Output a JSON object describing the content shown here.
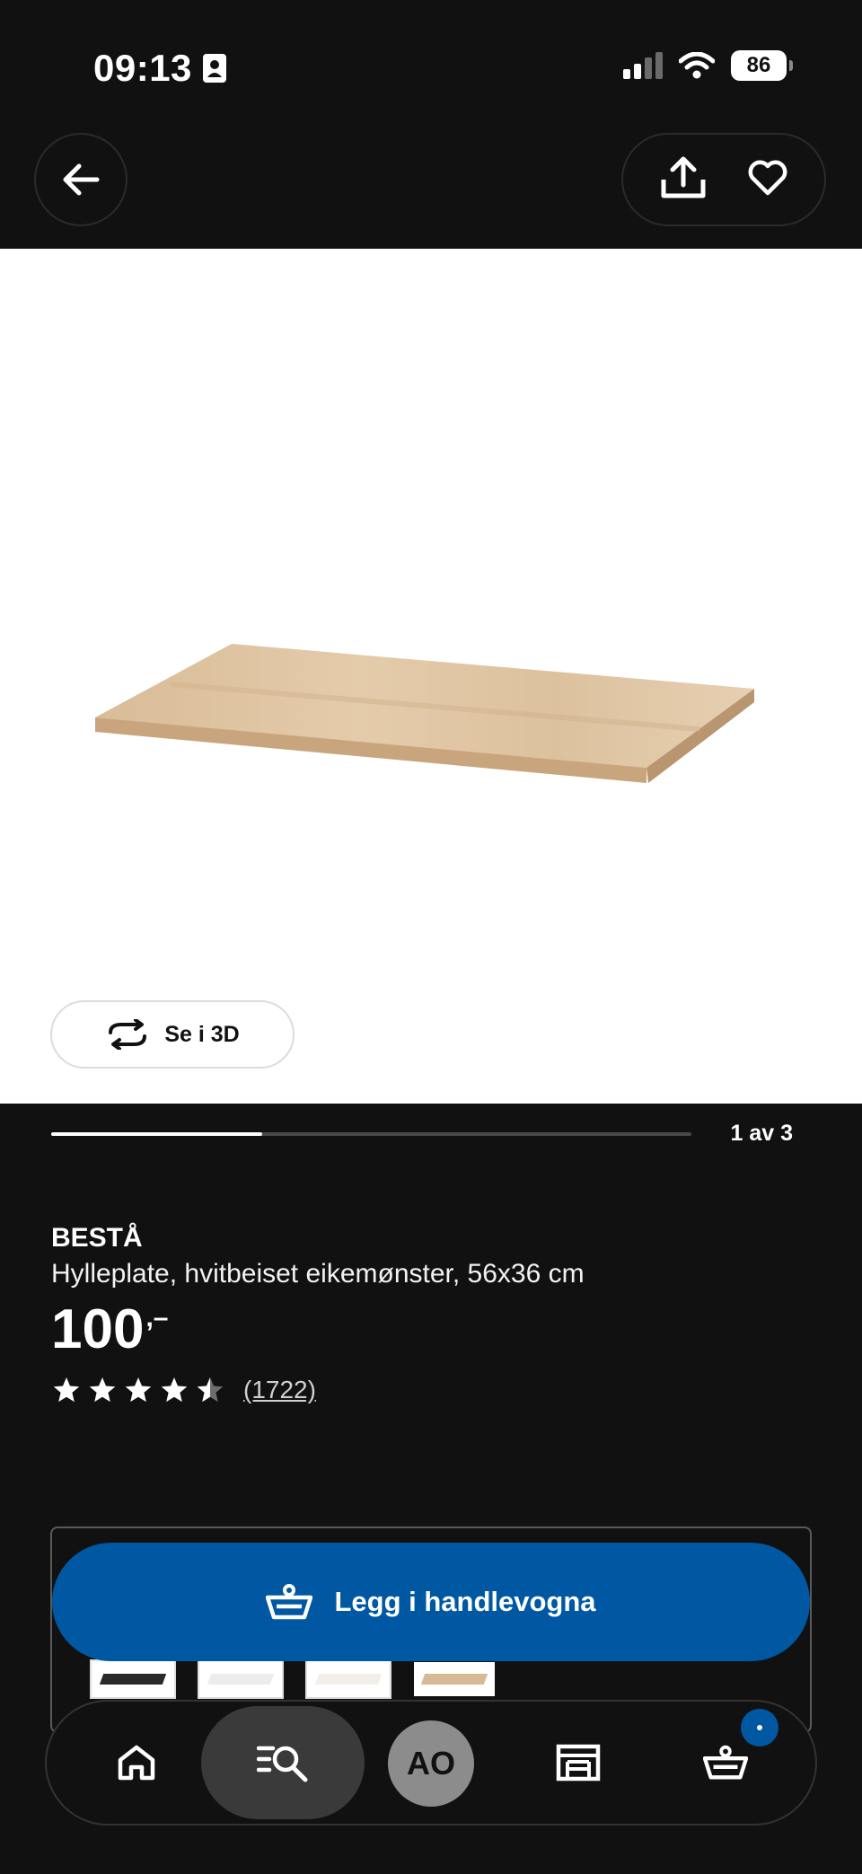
{
  "status_bar": {
    "time": "09:13",
    "battery": "86"
  },
  "header": {
    "back_icon": "arrow-left-icon",
    "share_icon": "share-icon",
    "favorite_icon": "heart-icon"
  },
  "gallery": {
    "view_3d_label": "Se i 3D",
    "page_indicator": "1 av 3",
    "progress": 0.33
  },
  "product": {
    "brand": "BESTÅ",
    "description": "Hylleplate, hvitbeiset eikemønster, 56x36 cm",
    "price": "100",
    "price_suffix": ",–",
    "rating": 4.5,
    "review_count": "(1722)"
  },
  "cta": {
    "add_to_cart_label": "Legg i handlevogna"
  },
  "bottom_nav": {
    "avatar_initials": "AO"
  },
  "colors": {
    "accent": "#0058a3",
    "background": "#111111"
  }
}
